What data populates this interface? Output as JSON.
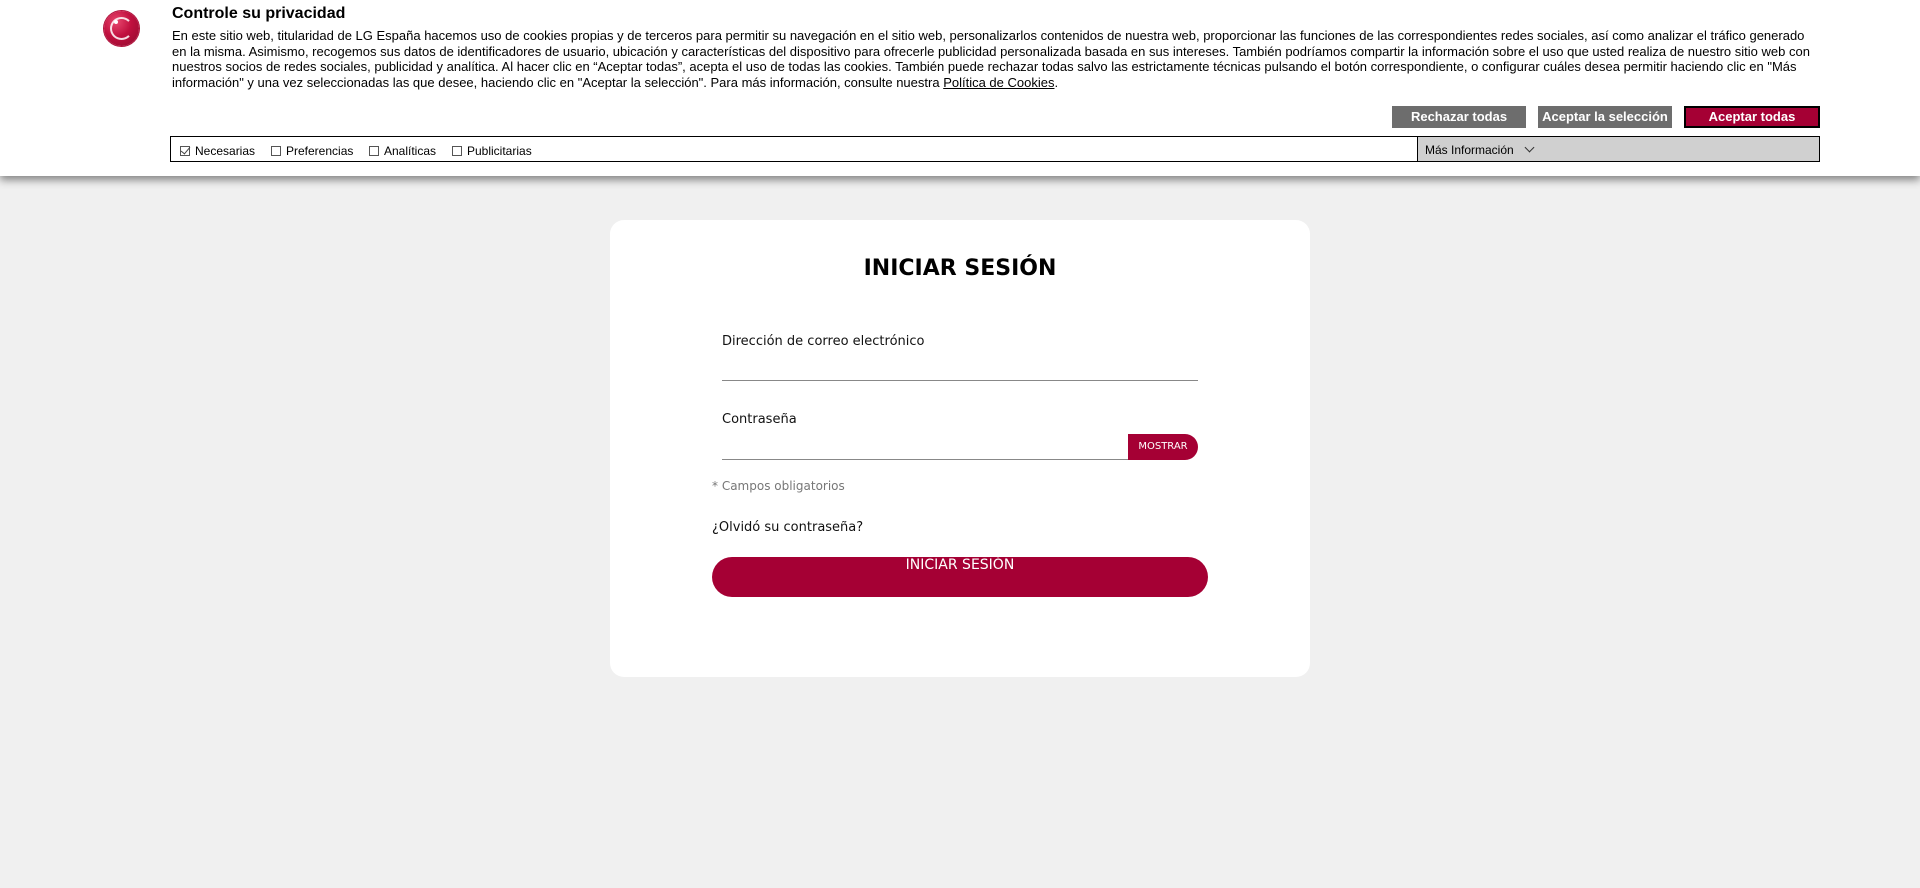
{
  "cookie_banner": {
    "logo_text": "LG",
    "title": "Controle su privacidad",
    "text_line_1": "En este sitio web, titularidad de LG España hacemos uso de cookies propias y de terceros para permitir su navegación en el sitio web, personalizarlos contenidos de nuestra web, proporcionar las funciones de las correspondientes redes sociales, así como analizar el tráfico generado en la",
    "text_line_2": "misma. Asimismo, recogemos sus datos de identificadores de usuario, ubicación y características del dispositivo para ofrecerle publicidad personalizada basada en sus intereses. También podríamos compartir la información sobre el uso que usted realiza de nuestro sitio web con nuestros",
    "text_line_3": "socios de redes sociales, publicidad y analítica. Al hacer clic en “Aceptar todas”, acepta el uso de todas las cookies. También puede rechazar todas salvo las estrictamente técnicas pulsando el botón correspondiente, o configurar cuáles desea permitir haciendo clic en \"Más información\" y una",
    "text_line_4": "vez seleccionadas las que desee, haciendo clic en \"Aceptar la selección\". Para más información, consulte nuestra",
    "policy_link": "Política de Cookies",
    "policy_suffix": ".",
    "buttons": {
      "reject_all": "Rechazar todas",
      "accept_selection": "Aceptar la selección",
      "accept_all": "Aceptar todas"
    },
    "categories": [
      {
        "label": "Necesarias",
        "checked": true
      },
      {
        "label": "Preferencias",
        "checked": false
      },
      {
        "label": "Analíticas",
        "checked": false
      },
      {
        "label": "Publicitarias",
        "checked": false
      }
    ],
    "more_info": "Más Información"
  },
  "login": {
    "title": "INICIAR SESIÓN",
    "email_label": "Dirección de correo electrónico",
    "email_value": "",
    "password_label": "Contraseña",
    "password_value": "",
    "show_button": "MOSTRAR",
    "required_note": "* Campos obligatorios",
    "forgot_link": "¿Olvidó su contraseña?",
    "submit_label": "INICIAR SESIÓN"
  },
  "colors": {
    "brand": "#a50034",
    "banner_button_gray": "#6d6d6d",
    "page_background": "#f0f0f0"
  },
  "icons": {
    "logo": "lg-logo-icon",
    "more_info": "chevron-down-icon"
  }
}
